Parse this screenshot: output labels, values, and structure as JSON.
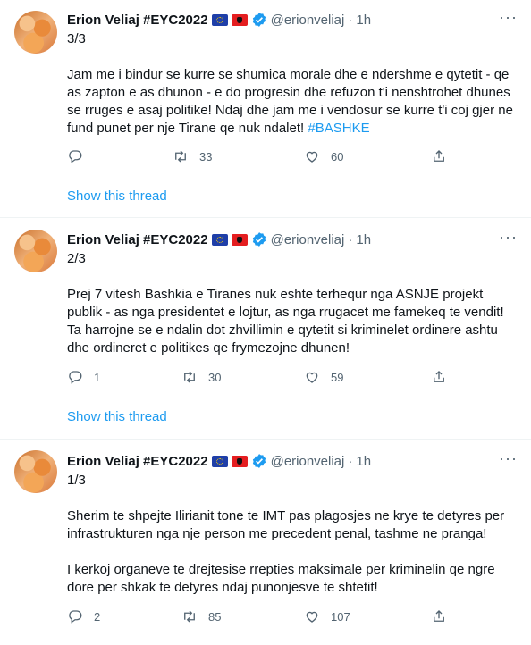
{
  "tweets": [
    {
      "name": "Erion Veliaj #EYC2022",
      "handle": "@erionveliaj",
      "dot": "·",
      "time": "1h",
      "thread_index": "3/3",
      "paragraphs": [
        "Jam me i bindur se kurre se shumica morale dhe e ndershme e qytetit - qe as zapton e as dhunon -  e do progresin dhe refuzon t'i nenshtrohet dhunes se rruges e asaj politike! Ndaj dhe jam me i vendosur se kurre t'i coj gjer ne fund punet per nje Tirane qe nuk ndalet!"
      ],
      "hashtag": "#BASHKE",
      "replies": "",
      "retweets": "33",
      "likes": "60",
      "show_thread": "Show this thread"
    },
    {
      "name": "Erion Veliaj #EYC2022",
      "handle": "@erionveliaj",
      "dot": "·",
      "time": "1h",
      "thread_index": "2/3",
      "paragraphs": [
        "Prej 7 vitesh Bashkia e Tiranes nuk eshte terhequr nga ASNJE projekt publik - as nga presidentet e lojtur, as nga rrugacet me famekeq te vendit! Ta harrojne se e ndalin dot zhvillimin e qytetit si kriminelet ordinere ashtu dhe ordineret e politikes qe frymezojne dhunen!"
      ],
      "hashtag": "",
      "replies": "1",
      "retweets": "30",
      "likes": "59",
      "show_thread": "Show this thread"
    },
    {
      "name": "Erion Veliaj #EYC2022",
      "handle": "@erionveliaj",
      "dot": "·",
      "time": "1h",
      "thread_index": "1/3",
      "paragraphs": [
        "Sherim te shpejte Ilirianit tone te IMT pas plagosjes ne krye te detyres per infrastrukturen nga nje person me precedent penal, tashme ne pranga!",
        "I kerkoj organeve te drejtesise rrepties maksimale per kriminelin qe ngre dore per shkak te detyres ndaj punonjesve te shtetit!"
      ],
      "hashtag": "",
      "replies": "2",
      "retweets": "85",
      "likes": "107",
      "show_thread": ""
    }
  ],
  "icons": {
    "reply": "reply-icon",
    "retweet": "retweet-icon",
    "like": "heart-icon",
    "share": "share-icon",
    "more": "more-icon",
    "verified": "verified-badge-icon"
  },
  "colors": {
    "link": "#1d9bf0",
    "muted": "#536471",
    "text": "#0f1419",
    "divider": "#eff3f4"
  }
}
